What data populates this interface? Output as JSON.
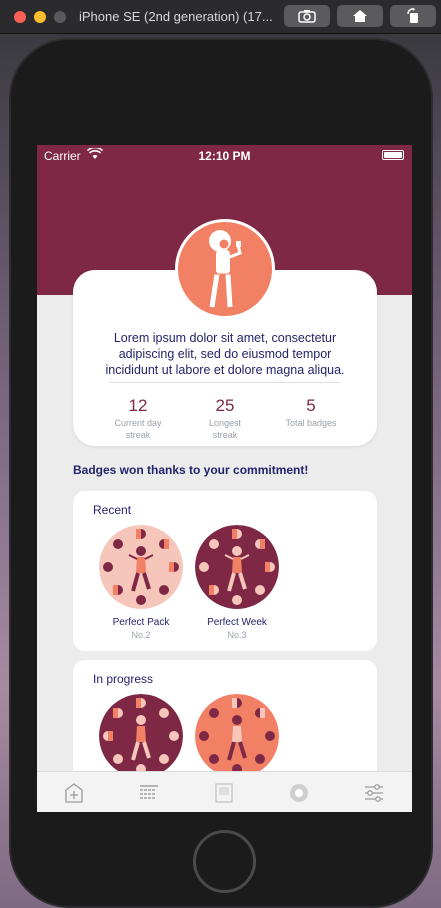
{
  "simulator": {
    "title": "iPhone SE (2nd generation) (17..."
  },
  "status_bar": {
    "carrier": "Carrier",
    "time": "12:10 PM"
  },
  "profile": {
    "bio": "Lorem ipsum dolor sit amet, consectetur adipiscing elit, sed do eiusmod tempor incididunt ut labore et dolore magna aliqua.",
    "stats": [
      {
        "value": "12",
        "label_line1": "Current day",
        "label_line2": "streak"
      },
      {
        "value": "25",
        "label_line1": "Longest",
        "label_line2": "streak"
      },
      {
        "value": "5",
        "label_line1": "Total badges",
        "label_line2": ""
      }
    ]
  },
  "badges_section": {
    "title": "Badges won thanks to your commitment!",
    "recent": {
      "title": "Recent",
      "items": [
        {
          "name": "Perfect Pack",
          "number": "No.2",
          "color": "#f6c6ba"
        },
        {
          "name": "Perfect Week",
          "number": "No.3",
          "color": "#7e2846"
        }
      ]
    },
    "in_progress": {
      "title": "In progress",
      "items": [
        {
          "color": "#7e2846"
        },
        {
          "color": "#f28064"
        }
      ]
    }
  },
  "colors": {
    "brand": "#7e2846",
    "accent": "#f28064",
    "text_dark": "#23246b",
    "muted": "#9aa0ad"
  },
  "tabbar": {
    "icons": [
      "add-icon",
      "calendar-icon",
      "book-icon",
      "badge-icon",
      "settings-sliders-icon"
    ]
  }
}
